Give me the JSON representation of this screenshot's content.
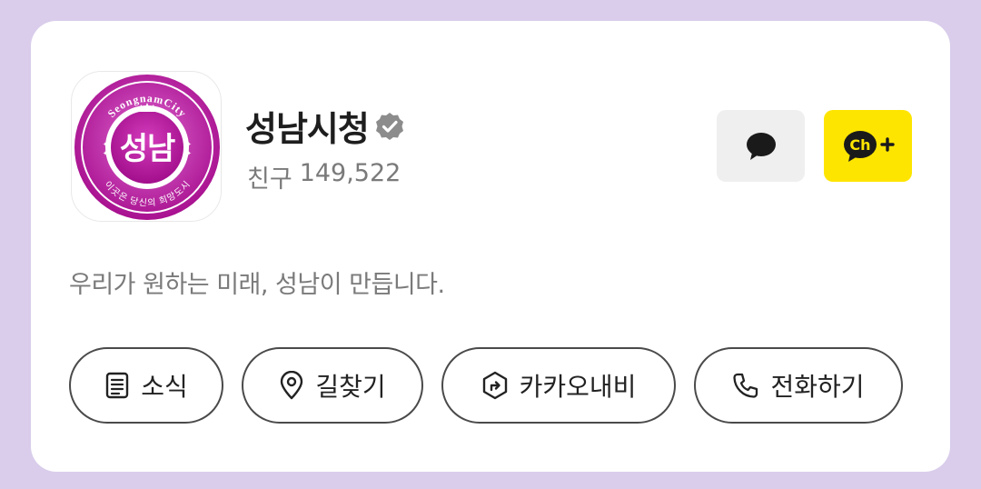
{
  "channel": {
    "logo": {
      "main_text": "성남",
      "ring_top_text": "SeongnamCity",
      "ring_bottom_text": "이곳은 당신의 희망도시",
      "colors": {
        "primary": "#b0179a",
        "ring": "#d04cc0"
      }
    },
    "name": "성남시청",
    "verified_icon": "verified-badge-icon",
    "friends_label": "친구",
    "friends_count": "149,522",
    "description": "우리가 원하는 미래, 성남이 만듭니다."
  },
  "header_buttons": {
    "chat": {
      "icon": "chat-bubble-icon"
    },
    "add_channel": {
      "icon": "channel-add-icon",
      "label": "Ch",
      "color": "#fee500"
    }
  },
  "actions": [
    {
      "label": "소식",
      "icon": "news-icon"
    },
    {
      "label": "길찾기",
      "icon": "location-pin-icon"
    },
    {
      "label": "카카오내비",
      "icon": "navigation-icon"
    },
    {
      "label": "전화하기",
      "icon": "phone-icon"
    }
  ]
}
